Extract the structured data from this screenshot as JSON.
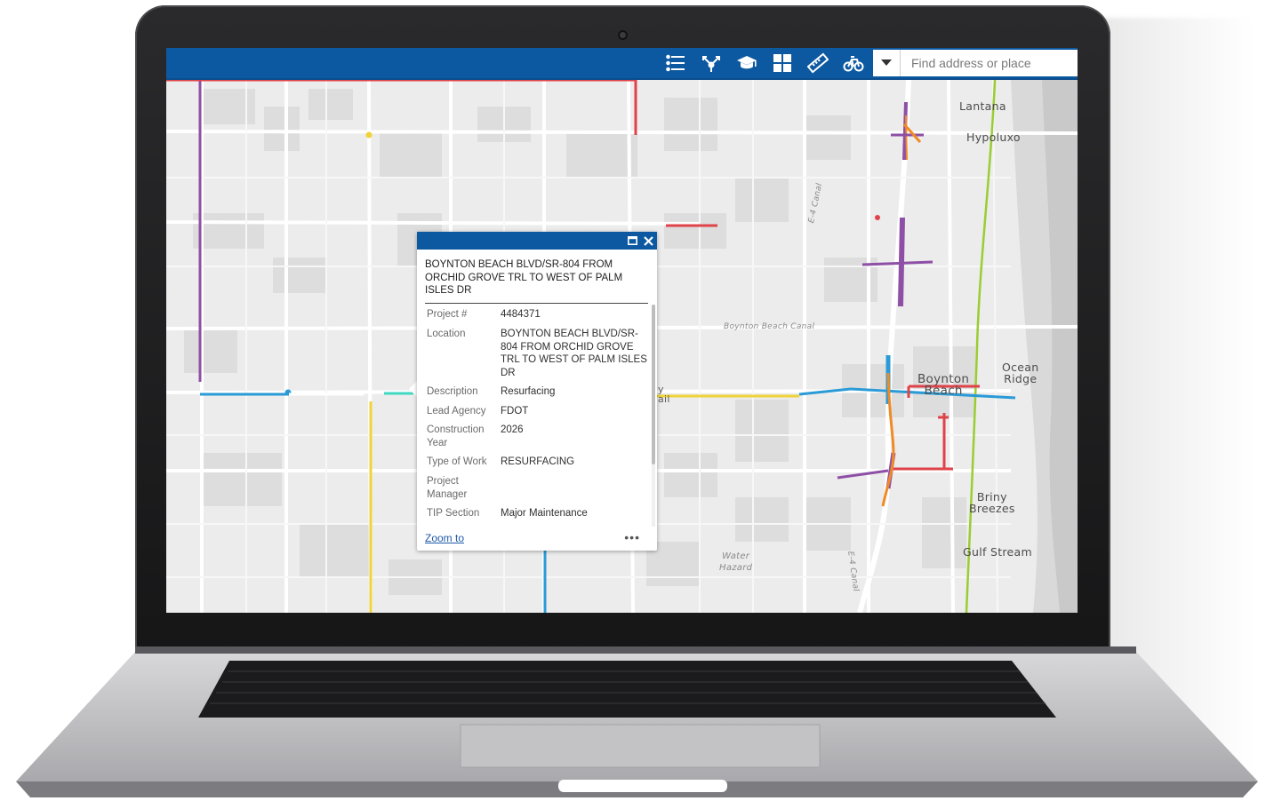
{
  "search": {
    "placeholder": "Find address or place"
  },
  "toolbar": {
    "icons": [
      "legend-list-icon",
      "layers-share-icon",
      "tutorial-cap-icon",
      "basemap-grid-icon",
      "measure-ruler-icon",
      "bike-icon"
    ],
    "dropdown_icon": "caret-down-icon"
  },
  "map_labels": {
    "lantana": "Lantana",
    "hypoluxo": "Hypoluxo",
    "ocean_ridge": "Ocean\nRidge",
    "boynton_beach": "Boynton\nBeach",
    "briny_breezes": "Briny\nBreezes",
    "gulf_stream": "Gulf Stream",
    "boynton_beach_canal": "Boynton Beach Canal",
    "e4_canal_top": "E-4 Canal",
    "e4_canal_bottom": "E-4 Canal",
    "water_hazard": "Water\nHazard",
    "partial_trail": "y\nail"
  },
  "popup": {
    "title": "BOYNTON BEACH BLVD/SR-804 FROM ORCHID GROVE TRL TO WEST OF PALM ISLES DR",
    "rows": [
      {
        "key": "Project #",
        "value": "4484371"
      },
      {
        "key": "Location",
        "value": "BOYNTON BEACH BLVD/SR-804 FROM ORCHID GROVE TRL TO WEST OF PALM ISLES DR"
      },
      {
        "key": "Description",
        "value": "Resurfacing"
      },
      {
        "key": "Lead Agency",
        "value": "FDOT"
      },
      {
        "key": "Construction Year",
        "value": "2026"
      },
      {
        "key": "Type of Work",
        "value": "RESURFACING"
      },
      {
        "key": "Project Manager",
        "value": ""
      },
      {
        "key": "TIP Section",
        "value": "Major Maintenance"
      }
    ],
    "zoom_to": "Zoom to",
    "more": "•••"
  },
  "colors": {
    "header_blue": "#0d59a1",
    "route_purple": "#8e4fa6",
    "route_blue": "#2a9bd6",
    "route_yellow": "#f0d33a",
    "route_red": "#e0424a",
    "route_orange": "#f08a24",
    "route_green": "#9acd32",
    "route_teal": "#3fd8c0"
  }
}
